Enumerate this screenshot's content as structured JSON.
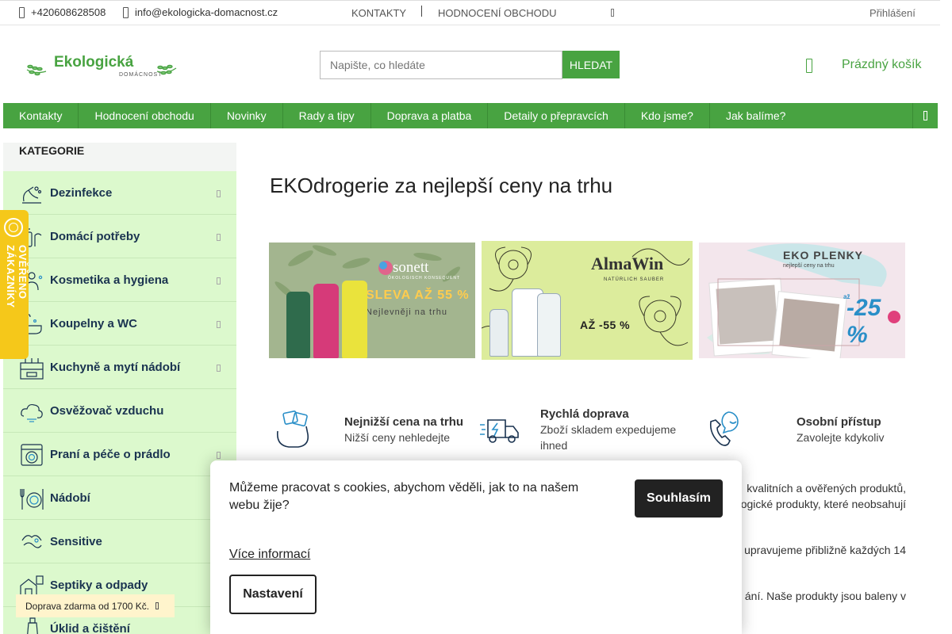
{
  "topbar": {
    "phone": "+420608628508",
    "email": "info@ekologicka-domacnost.cz",
    "contacts": "KONTAKTY",
    "reviews": "HODNOCENÍ OBCHODU",
    "login": "Přihlášení"
  },
  "header": {
    "logo_text": "Ekologická",
    "logo_sub": "DOMÁCNOST",
    "search_placeholder": "Napište, co hledáte",
    "search_button": "HLEDAT",
    "cart_label": "Prázdný košík"
  },
  "nav": {
    "items": [
      "Kontakty",
      "Hodnocení obchodu",
      "Novinky",
      "Rady a tipy",
      "Doprava a platba",
      "Detaily o přepravcích",
      "Kdo jsme?",
      "Jak balíme?"
    ]
  },
  "sidebar": {
    "title": "KATEGORIE",
    "categories": [
      {
        "label": "Dezinfekce",
        "icon": "disinfection-icon"
      },
      {
        "label": "Domácí potřeby",
        "icon": "household-icon"
      },
      {
        "label": "Kosmetika a hygiena",
        "icon": "cosmetics-icon"
      },
      {
        "label": "Koupelny a WC",
        "icon": "bathroom-icon"
      },
      {
        "label": "Kuchyně a mytí nádobí",
        "icon": "kitchen-icon"
      },
      {
        "label": "Osvěžovač vzduchu",
        "icon": "air-freshener-icon"
      },
      {
        "label": "Praní a péče o prádlo",
        "icon": "laundry-icon"
      },
      {
        "label": "Nádobí",
        "icon": "dishes-icon"
      },
      {
        "label": "Sensitive",
        "icon": "sensitive-icon"
      },
      {
        "label": "Septiky a odpady",
        "icon": "septic-icon"
      },
      {
        "label": "Úklid a čištění",
        "icon": "cleaning-icon"
      }
    ]
  },
  "badge": {
    "text": "OVĚŘENO ZÁKAZNÍKY"
  },
  "main": {
    "title": "EKOdrogerie za nejlepší ceny na trhu",
    "banners": {
      "sonett": {
        "logo": "sonett",
        "sub": "ÖKOLOGISCH KONSEQUENT",
        "discount": "SLEVA AŽ 55 %",
        "tagline": "Nejlevněji na trhu"
      },
      "almawin": {
        "logo": "AlmaWin",
        "sub": "NATÜRLICH SAUBER",
        "discount": "AŽ -55 %"
      },
      "plenky": {
        "title": "EKO PLENKY",
        "sub": "nejlepší ceny na trhu",
        "pre": "až",
        "discount": "-25 %"
      }
    },
    "features": [
      {
        "title": "Nejnižší cena na trhu",
        "desc": "Nižší ceny nehledejte"
      },
      {
        "title": "Rychlá doprava",
        "desc": "Zboží skladem expedujeme ihned"
      },
      {
        "title": "Osobní přístup",
        "desc": "Zavolejte kdykoliv"
      }
    ],
    "body_fragments": [
      "kvalitních a ověřených produktů,",
      "ogické produkty, které neobsahují",
      "upravujeme přibližně každých 14",
      "ání. Naše produkty jsou baleny v"
    ]
  },
  "cookie": {
    "message": "Můžeme pracovat s cookies, abychom věděli, jak to na našem webu žije?",
    "accept": "Souhlasím",
    "more": "Více informací",
    "settings": "Nastavení"
  },
  "toast": {
    "text": "Doprava zdarma od 1700 Kč."
  },
  "colors": {
    "brand_green": "#48a341",
    "category_bg": "#dcf9cd",
    "badge_yellow": "#f5c81a",
    "link_dark": "#1a3350"
  }
}
